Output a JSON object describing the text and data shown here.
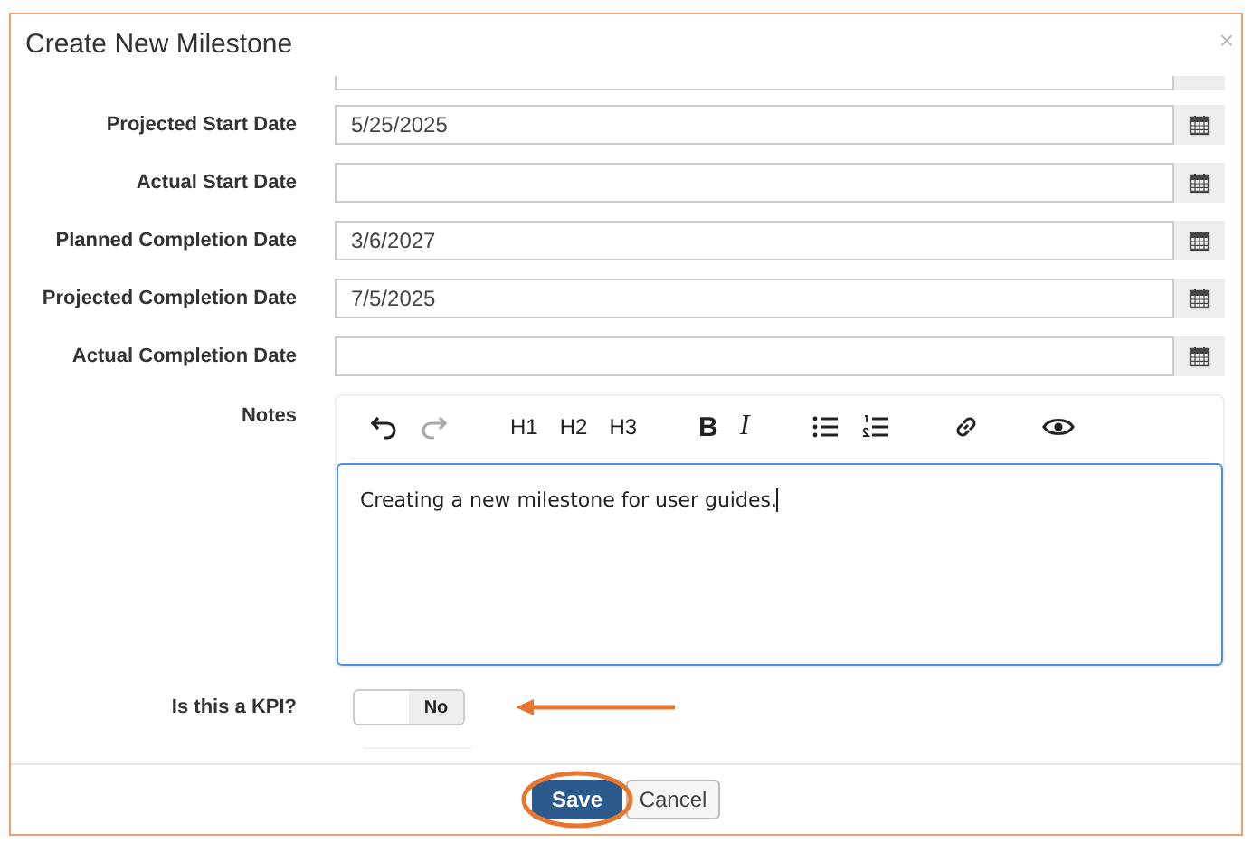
{
  "dialog": {
    "title": "Create New Milestone",
    "close": "×"
  },
  "fields": [
    {
      "partial": true
    },
    {
      "partial": false,
      "label": "Projected Start Date",
      "value": "5/25/2025"
    },
    {
      "partial": false,
      "label": "Actual Start Date"
    },
    {
      "partial": false,
      "label": "Planned Completion Date",
      "value": "3/6/2027"
    },
    {
      "partial": false,
      "label": "Projected Completion Date",
      "value": "7/5/2025"
    },
    {
      "partial": false,
      "label": "Actual Completion Date"
    }
  ],
  "notes": {
    "label": "Notes",
    "toolbar": [
      {
        "kind": "undo",
        "disabled": false
      },
      {
        "kind": "redo",
        "disabled": true
      },
      {
        "kind": "heading",
        "label": "H1",
        "disabled": false
      },
      {
        "kind": "heading",
        "label": "H2",
        "disabled": false
      },
      {
        "kind": "heading",
        "label": "H3",
        "disabled": false
      },
      {
        "kind": "bold",
        "label": "B",
        "disabled": false
      },
      {
        "kind": "italic",
        "label": "I",
        "disabled": false
      },
      {
        "kind": "bullet-list",
        "disabled": false
      },
      {
        "kind": "numbered-list",
        "disabled": false
      },
      {
        "kind": "link",
        "disabled": false
      },
      {
        "kind": "preview",
        "disabled": false
      }
    ],
    "text": "Creating a new milestone for user guides."
  },
  "kpi": {
    "label": "Is this a KPI?",
    "toggle_label": "No",
    "on": false
  },
  "buttons": [
    {
      "label": "Save",
      "kind": "primary"
    },
    {
      "label": "Cancel",
      "kind": "secondary"
    }
  ]
}
